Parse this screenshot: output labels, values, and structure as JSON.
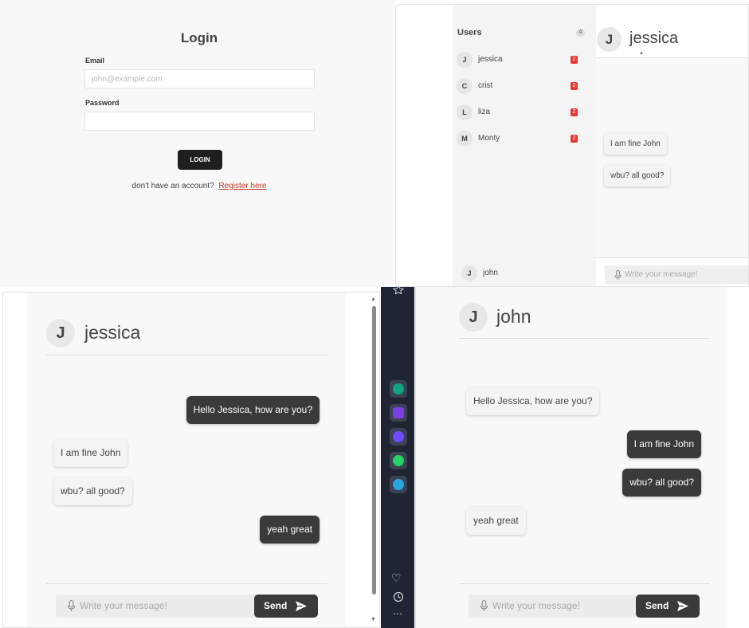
{
  "login": {
    "title": "Login",
    "email_label": "Email",
    "email_placeholder": "john@example.com",
    "password_label": "Password",
    "login_button": "LOGIN",
    "no_account_text": "don't have an account?",
    "register_link": "Register here"
  },
  "chat_sidebar_view": {
    "users_title": "Users",
    "users_count": "4",
    "users": [
      {
        "initial": "J",
        "name": "jessica",
        "unread": "2"
      },
      {
        "initial": "C",
        "name": "crist",
        "unread": "2"
      },
      {
        "initial": "L",
        "name": "liza",
        "unread": "2"
      },
      {
        "initial": "M",
        "name": "Monty",
        "unread": "2"
      }
    ],
    "current_user": {
      "initial": "J",
      "name": "john"
    },
    "header": {
      "initial": "J",
      "name": "jessica"
    },
    "messages": [
      {
        "side": "left",
        "text": "I am fine John"
      },
      {
        "side": "left",
        "text": "wbu? all good?"
      }
    ],
    "message_placeholder": "Write your message!"
  },
  "chat_jessica": {
    "header": {
      "initial": "J",
      "name": "jessica"
    },
    "messages": [
      {
        "side": "right",
        "text": "Hello Jessica, how are you?"
      },
      {
        "side": "left",
        "text": "I am fine John"
      },
      {
        "side": "left",
        "text": "wbu? all good?"
      },
      {
        "side": "right",
        "text": "yeah great"
      }
    ],
    "message_placeholder": "Write your message!",
    "send_label": "Send"
  },
  "chat_john": {
    "header": {
      "initial": "J",
      "name": "john"
    },
    "messages": [
      {
        "side": "left",
        "text": "Hello Jessica, how are you?"
      },
      {
        "side": "right",
        "text": "I am fine John"
      },
      {
        "side": "right",
        "text": "wbu? all good?"
      },
      {
        "side": "left",
        "text": "yeah great"
      }
    ],
    "message_placeholder": "Write your message!",
    "send_label": "Send"
  },
  "dock": {
    "icons": [
      "chatgpt-icon",
      "copilot-icon",
      "messenger-icon",
      "whatsapp-icon",
      "telegram-icon",
      "favorites-icon",
      "history-icon",
      "more-icon"
    ],
    "accent_colors": {
      "chatgpt": "#10a37f",
      "copilot": "#7b3fe4",
      "messenger": "#6f4bff",
      "whatsapp": "#25d366",
      "telegram": "#2aa5e0"
    }
  }
}
